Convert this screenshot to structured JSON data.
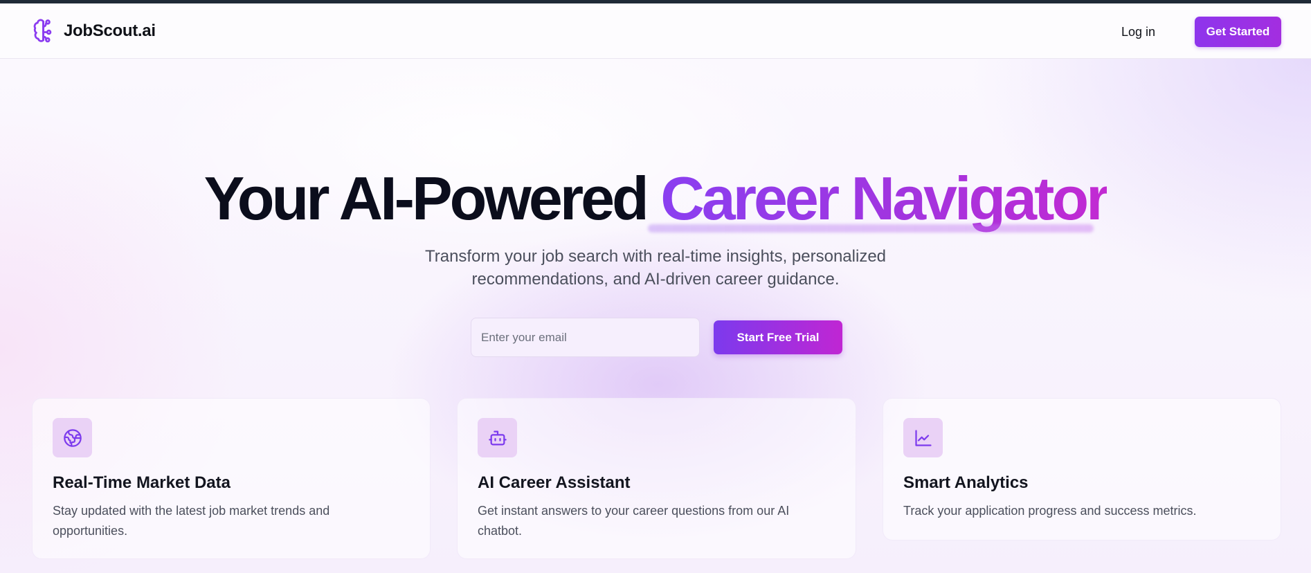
{
  "brand": {
    "name": "JobScout.ai",
    "logo_icon": "brain-icon",
    "accent": "#8b3cf0"
  },
  "nav": {
    "login_label": "Log in",
    "cta_label": "Get Started"
  },
  "hero": {
    "title_main": "Your AI-Powered",
    "title_highlight": "Career Navigator",
    "subtitle": "Transform your job search with real-time insights, personalized recommendations, and AI-driven career guidance.",
    "email_placeholder": "Enter your email",
    "cta_label": "Start Free Trial"
  },
  "features": [
    {
      "icon": "globe-icon",
      "title": "Real-Time Market Data",
      "description": "Stay updated with the latest job market trends and opportunities."
    },
    {
      "icon": "robot-icon",
      "title": "AI Career Assistant",
      "description": "Get instant answers to your career questions from our AI chatbot."
    },
    {
      "icon": "line-chart-icon",
      "title": "Smart Analytics",
      "description": "Track your application progress and success metrics."
    }
  ]
}
